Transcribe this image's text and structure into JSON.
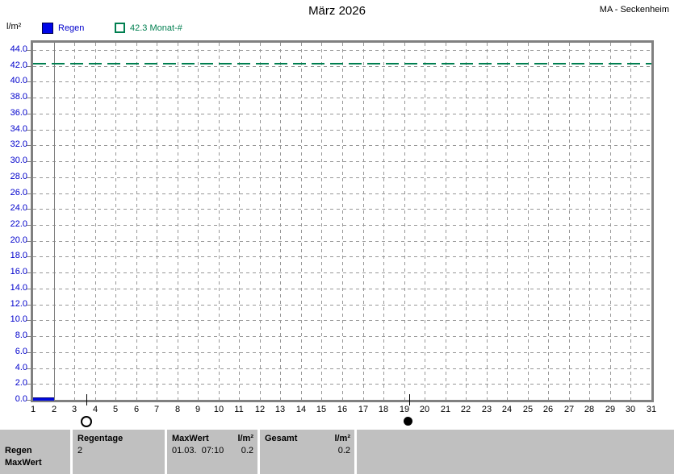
{
  "header": {
    "title": "März 2026",
    "station": "MA - Seckenheim"
  },
  "chart_data": {
    "type": "bar",
    "title": "März 2026",
    "xlabel": "",
    "ylabel": "l/m²",
    "ylim": [
      0,
      44
    ],
    "yticks": [
      0,
      2,
      4,
      6,
      8,
      10,
      12,
      14,
      16,
      18,
      20,
      22,
      24,
      26,
      28,
      30,
      32,
      34,
      36,
      38,
      40,
      42,
      44
    ],
    "xticks": [
      1,
      2,
      3,
      4,
      5,
      6,
      7,
      8,
      9,
      10,
      11,
      12,
      13,
      14,
      15,
      16,
      17,
      18,
      19,
      20,
      21,
      22,
      23,
      24,
      25,
      26,
      27,
      28,
      29,
      30,
      31
    ],
    "grid": true,
    "legend_position": "top-left",
    "series": [
      {
        "name": "Regen",
        "color": "#0008dd",
        "values": [
          0.2,
          0,
          0,
          0,
          0,
          0,
          0,
          0,
          0,
          0,
          0,
          0,
          0,
          0,
          0,
          0,
          0,
          0,
          0,
          0,
          0,
          0,
          0,
          0,
          0,
          0,
          0,
          0,
          0,
          0,
          0
        ]
      }
    ],
    "reference_line": {
      "label": "42.3 Monat-#",
      "value": 42.3,
      "color": "#007f50",
      "style": "dashed"
    },
    "day_marker_line": {
      "day": 2,
      "style": "solid",
      "color": "#808080"
    },
    "moon_phases": [
      {
        "day": 3.6,
        "phase": "full"
      },
      {
        "day": 19.25,
        "phase": "new"
      }
    ]
  },
  "table": {
    "row_labels": [
      "Regen",
      "MaxWert"
    ],
    "columns": [
      {
        "header": "Regentage",
        "value": "2"
      },
      {
        "header": "MaxWert",
        "unit": "l/m²",
        "value": "01.03.  07:10",
        "unit_value": "0.2"
      },
      {
        "header": "Gesamt",
        "unit": "l/m²",
        "value": "",
        "unit_value": "0.2"
      }
    ]
  }
}
